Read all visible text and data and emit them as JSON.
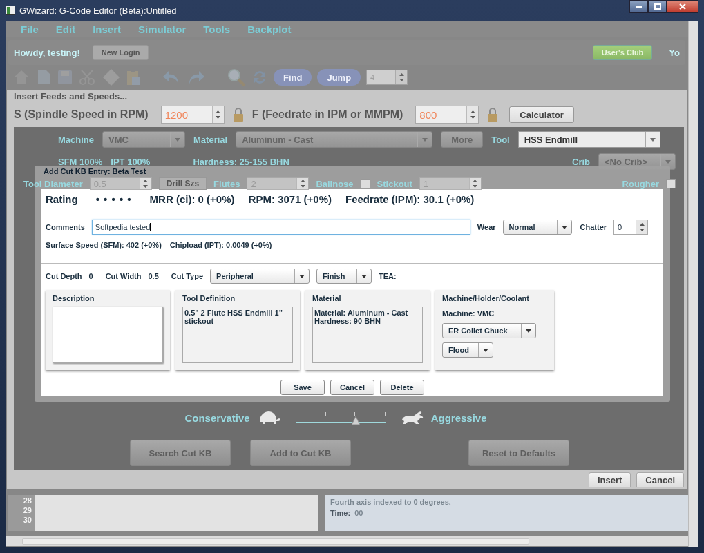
{
  "window": {
    "title": "GWizard: G-Code Editor (Beta):Untitled"
  },
  "menu": [
    "File",
    "Edit",
    "Insert",
    "Simulator",
    "Tools",
    "Backplot"
  ],
  "user_bar": {
    "greeting": "Howdy, testing!",
    "login_button": "New Login",
    "club_button": "User's Club",
    "cut_text": "Yo"
  },
  "toolbar": {
    "find_button": "Find",
    "jump_button": "Jump",
    "jump_value": "4"
  },
  "feeds_panel": {
    "title": "Insert Feeds and Speeds...",
    "spindle_label": "S (Spindle Speed in RPM)",
    "spindle_value": "1200",
    "feed_label": "F (Feedrate in IPM or MMPM)",
    "feed_value": "800",
    "calculator_button": "Calculator",
    "machine": {
      "label": "Machine",
      "value": "VMC"
    },
    "material": {
      "label": "Material",
      "value": "Aluminum - Cast"
    },
    "more_button": "More",
    "tool": {
      "label": "Tool",
      "value": "HSS Endmill"
    },
    "sfm": "SFM 100%",
    "ipt": "IPT 100%",
    "hardness": "Hardness: 25-155 BHN",
    "crib": {
      "label": "Crib",
      "value": "<No Crib>"
    },
    "tool_row": {
      "diameter_label": "Tool Diameter",
      "diameter_value": "0.5",
      "drill_button": "Drill Szs",
      "flutes_label": "Flutes",
      "flutes_value": "2",
      "ballnose_label": "Ballnose",
      "ballnose_checked": false,
      "stickout_label": "Stickout",
      "stickout_value": "1",
      "rougher_label": "Rougher",
      "rougher_checked": false
    },
    "slider": {
      "left_label": "Conservative",
      "right_label": "Aggressive",
      "level": 0.67
    },
    "buttons": [
      "Search Cut KB",
      "Add to Cut KB",
      "Reset to Defaults"
    ],
    "insert_button": "Insert",
    "cancel_button": "Cancel"
  },
  "dialog": {
    "title": "Add Cut KB Entry: Beta Test",
    "rating_label": "Rating",
    "rating_dots": "• • • • •",
    "mrr": "MRR (ci): 0 (+0%)",
    "rpm": "RPM: 3071 (+0%)",
    "feedrate": "Feedrate (IPM): 30.1 (+0%)",
    "comments_label": "Comments",
    "comments_value": "Softpedia tested",
    "wear_label": "Wear",
    "wear_value": "Normal",
    "chatter_label": "Chatter",
    "chatter_value": "0",
    "surface_speed": "Surface Speed (SFM): 402 (+0%)",
    "chipload": "Chipload (IPT): 0.0049 (+0%)",
    "cut_depth_label": "Cut Depth",
    "cut_depth_value": "0",
    "cut_width_label": "Cut Width",
    "cut_width_value": "0.5",
    "cut_type_label": "Cut Type",
    "cut_type_value": "Peripheral",
    "pass_value": "Finish",
    "tea_label": "TEA:",
    "cards": [
      {
        "kind": "textarea",
        "title": "Description"
      },
      {
        "kind": "textarea",
        "title": "Tool Definition",
        "lines": [
          "0.5\" 2 Flute HSS Endmill  1\" stickout"
        ]
      },
      {
        "kind": "textarea",
        "title": "Material",
        "lines": [
          "Material: Aluminum - Cast",
          "Hardness: 90 BHN"
        ]
      },
      {
        "kind": "selects",
        "title": "Machine/Holder/Coolant",
        "lines": [
          "Machine: VMC"
        ],
        "selects": [
          "ER Collet Chuck",
          "Flood"
        ]
      }
    ],
    "buttons": [
      "Save",
      "Cancel",
      "Delete"
    ]
  },
  "editor": {
    "line_numbers": [
      "28",
      "29",
      "30"
    ],
    "message": "Fourth axis indexed to 0 degrees.",
    "time_label": "Time:",
    "time_value": "00"
  }
}
